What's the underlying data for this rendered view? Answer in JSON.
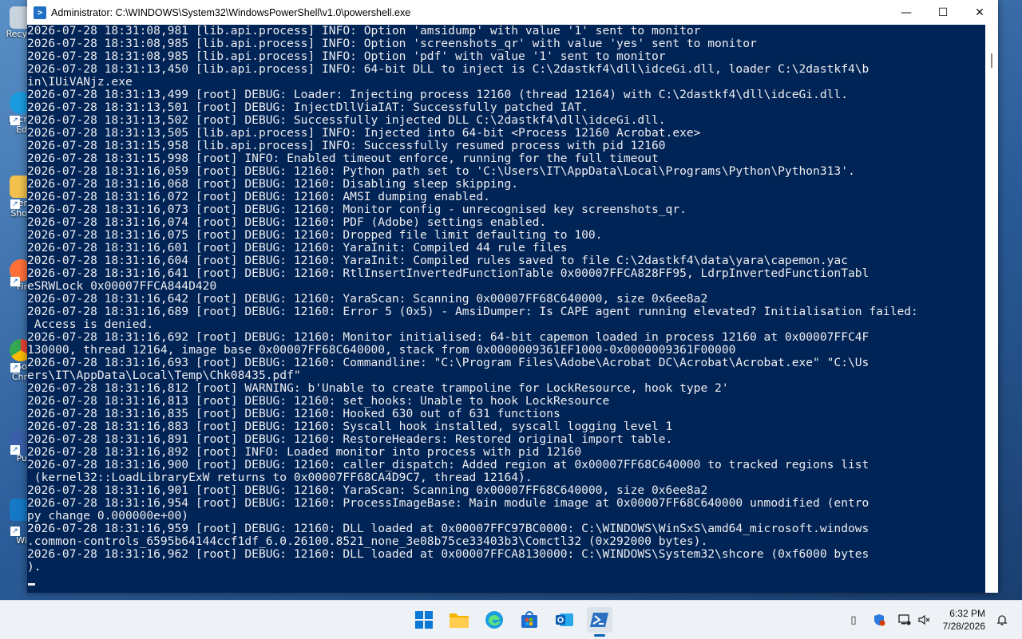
{
  "window": {
    "title": "Administrator: C:\\WINDOWS\\System32\\WindowsPowerShell\\v1.0\\powershell.exe",
    "minimize": "—",
    "maximize": "☐",
    "close": "✕"
  },
  "console_lines": [
    "2026-07-28 18:31:08,981 [lib.api.process] INFO: Option 'amsidump' with value '1' sent to monitor",
    "2026-07-28 18:31:08,985 [lib.api.process] INFO: Option 'screenshots_qr' with value 'yes' sent to monitor",
    "2026-07-28 18:31:08,985 [lib.api.process] INFO: Option 'pdf' with value '1' sent to monitor",
    "2026-07-28 18:31:13,450 [lib.api.process] INFO: 64-bit DLL to inject is C:\\2dastkf4\\dll\\idceGi.dll, loader C:\\2dastkf4\\b",
    "in\\IUiVANjz.exe",
    "2026-07-28 18:31:13,499 [root] DEBUG: Loader: Injecting process 12160 (thread 12164) with C:\\2dastkf4\\dll\\idceGi.dll.",
    "2026-07-28 18:31:13,501 [root] DEBUG: InjectDllViaIAT: Successfully patched IAT.",
    "2026-07-28 18:31:13,502 [root] DEBUG: Successfully injected DLL C:\\2dastkf4\\dll\\idceGi.dll.",
    "2026-07-28 18:31:13,505 [lib.api.process] INFO: Injected into 64-bit <Process 12160 Acrobat.exe>",
    "2026-07-28 18:31:15,958 [lib.api.process] INFO: Successfully resumed process with pid 12160",
    "2026-07-28 18:31:15,998 [root] INFO: Enabled timeout enforce, running for the full timeout",
    "2026-07-28 18:31:16,059 [root] DEBUG: 12160: Python path set to 'C:\\Users\\IT\\AppData\\Local\\Programs\\Python\\Python313'.",
    "2026-07-28 18:31:16,068 [root] DEBUG: 12160: Disabling sleep skipping.",
    "2026-07-28 18:31:16,072 [root] DEBUG: 12160: AMSI dumping enabled.",
    "2026-07-28 18:31:16,073 [root] DEBUG: 12160: Monitor config - unrecognised key screenshots_qr.",
    "2026-07-28 18:31:16,074 [root] DEBUG: 12160: PDF (Adobe) settings enabled.",
    "2026-07-28 18:31:16,075 [root] DEBUG: 12160: Dropped file limit defaulting to 100.",
    "2026-07-28 18:31:16,601 [root] DEBUG: 12160: YaraInit: Compiled 44 rule files",
    "2026-07-28 18:31:16,604 [root] DEBUG: 12160: YaraInit: Compiled rules saved to file C:\\2dastkf4\\data\\yara\\capemon.yac",
    "2026-07-28 18:31:16,641 [root] DEBUG: 12160: RtlInsertInvertedFunctionTable 0x00007FFCA828FF95, LdrpInvertedFunctionTabl",
    "eSRWLock 0x00007FFCA844D420",
    "2026-07-28 18:31:16,642 [root] DEBUG: 12160: YaraScan: Scanning 0x00007FF68C640000, size 0x6ee8a2",
    "2026-07-28 18:31:16,689 [root] DEBUG: 12160: Error 5 (0x5) - AmsiDumper: Is CAPE agent running elevated? Initialisation failed:",
    " Access is denied.",
    "2026-07-28 18:31:16,692 [root] DEBUG: 12160: Monitor initialised: 64-bit capemon loaded in process 12160 at 0x00007FFC4F",
    "130000, thread 12164, image base 0x00007FF68C640000, stack from 0x0000009361EF1000-0x0000009361F00000",
    "2026-07-28 18:31:16,693 [root] DEBUG: 12160: Commandline: \"C:\\Program Files\\Adobe\\Acrobat DC\\Acrobat\\Acrobat.exe\" \"C:\\Us",
    "ers\\IT\\AppData\\Local\\Temp\\Chk08435.pdf\"",
    "2026-07-28 18:31:16,812 [root] WARNING: b'Unable to create trampoline for LockResource, hook type 2'",
    "2026-07-28 18:31:16,813 [root] DEBUG: 12160: set_hooks: Unable to hook LockResource",
    "2026-07-28 18:31:16,835 [root] DEBUG: 12160: Hooked 630 out of 631 functions",
    "2026-07-28 18:31:16,883 [root] DEBUG: 12160: Syscall hook installed, syscall logging level 1",
    "2026-07-28 18:31:16,891 [root] DEBUG: 12160: RestoreHeaders: Restored original import table.",
    "2026-07-28 18:31:16,892 [root] INFO: Loaded monitor into process with pid 12160",
    "2026-07-28 18:31:16,900 [root] DEBUG: 12160: caller_dispatch: Added region at 0x00007FF68C640000 to tracked regions list",
    " (kernel32::LoadLibraryExW returns to 0x00007FF68CA4D9C7, thread 12164).",
    "2026-07-28 18:31:16,901 [root] DEBUG: 12160: YaraScan: Scanning 0x00007FF68C640000, size 0x6ee8a2",
    "2026-07-28 18:31:16,954 [root] DEBUG: 12160: ProcessImageBase: Main module image at 0x00007FF68C640000 unmodified (entro",
    "py change 0.000000e+00)",
    "2026-07-28 18:31:16,959 [root] DEBUG: 12160: DLL loaded at 0x00007FFC97BC0000: C:\\WINDOWS\\WinSxS\\amd64_microsoft.windows",
    ".common-controls_6595b64144ccf1df_6.0.26100.8521_none_3e08b75ce33403b3\\Comctl32 (0x292000 bytes).",
    "2026-07-28 18:31:16,962 [root] DEBUG: 12160: DLL loaded at 0x00007FFCA8130000: C:\\WINDOWS\\System32\\shcore (0xf6000 bytes",
    ")."
  ],
  "desktop_icons": [
    {
      "label": "Recy",
      "icon": "recycle-bin-icon",
      "color": "#c9d4de"
    },
    {
      "label": "Micr",
      "label2": "Ed",
      "icon": "edge-icon",
      "color": "#1a9be0"
    },
    {
      "label": "Ter",
      "label2": "Sho",
      "icon": "folder-icon",
      "color": "#f2c14e"
    },
    {
      "label": "Fir",
      "icon": "firefox-icon",
      "color": "#ff7139"
    },
    {
      "label": "Go",
      "label2": "Chr",
      "icon": "chrome-icon",
      "color": "#34a853"
    },
    {
      "label": "Pu",
      "icon": "putty-icon",
      "color": "#3b5fa8"
    },
    {
      "label": "Wi",
      "icon": "wireshark-icon",
      "color": "#1679c6"
    }
  ],
  "taskbar": {
    "apps": [
      {
        "name": "start-button",
        "icon": "windows-logo-icon"
      },
      {
        "name": "file-explorer",
        "icon": "folder-icon"
      },
      {
        "name": "edge",
        "icon": "edge-icon"
      },
      {
        "name": "microsoft-store",
        "icon": "store-icon"
      },
      {
        "name": "outlook",
        "icon": "outlook-icon"
      },
      {
        "name": "powershell",
        "icon": "powershell-icon",
        "active": true
      }
    ],
    "clock_time": "6:32 PM",
    "clock_date": "7/28/2026"
  }
}
